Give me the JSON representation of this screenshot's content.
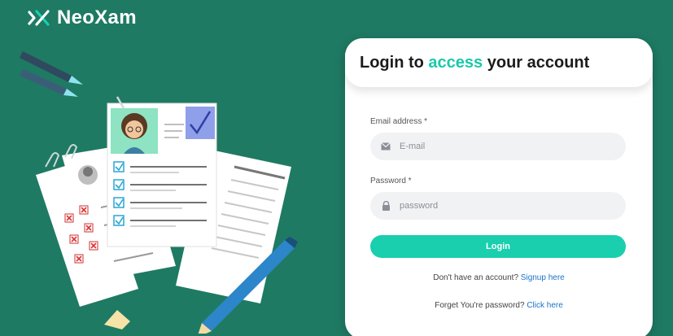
{
  "brand": {
    "name": "NeoXam",
    "logo_icon": "neoxam-x-logo-icon",
    "colors": {
      "background": "#1f7a63",
      "accent": "#19c9a9",
      "button": "#19cfae",
      "link": "#1a73c9"
    }
  },
  "illustration": {
    "icons": [
      "pencil-icon",
      "checklist-document-icon",
      "avatar-document-icon",
      "checkmark-icon",
      "cross-mark-icon",
      "paper-clip-icon"
    ]
  },
  "login_card": {
    "title_prefix": "Login to ",
    "title_highlight": "access",
    "title_suffix": " your account",
    "email": {
      "label": "Email address *",
      "placeholder": "E-mail",
      "value": "",
      "icon": "mail-icon"
    },
    "password": {
      "label": "Password *",
      "placeholder": "password",
      "value": "",
      "icon": "lock-icon"
    },
    "login_button_label": "Login",
    "signup_prompt": "Don't have an account?",
    "signup_link": "Signup here",
    "forgot_prompt": "Forget You're password?",
    "forgot_link": "Click here"
  }
}
